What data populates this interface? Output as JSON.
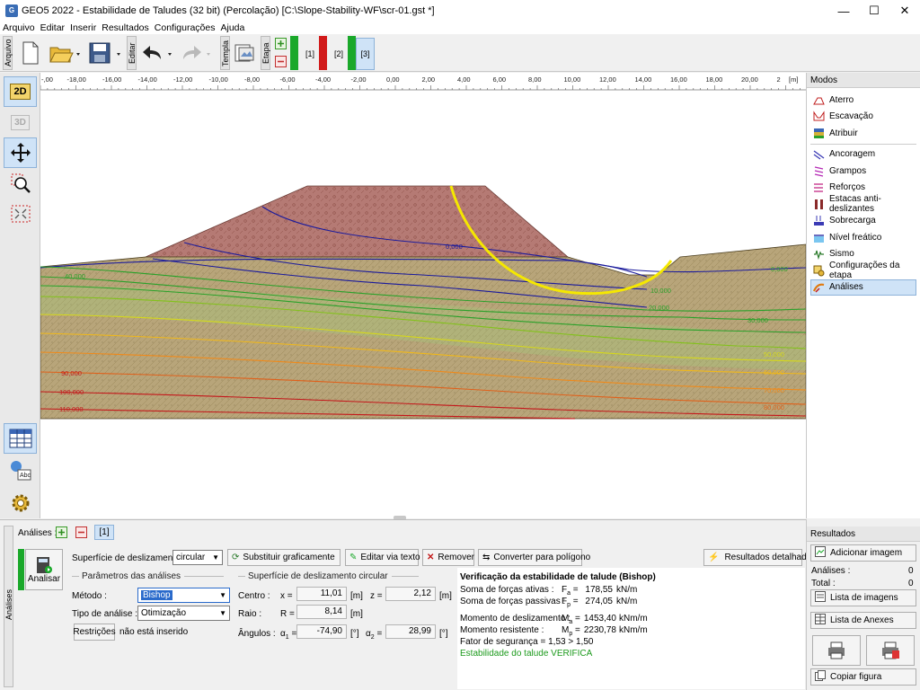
{
  "window": {
    "title": "GEO5 2022 - Estabilidade de Taludes (32 bit) (Percolação) [C:\\Slope-Stability-WF\\scr-01.gst *]",
    "app_icon": "G",
    "minimize": "—",
    "maximize": "☐",
    "close": "✕"
  },
  "menu": [
    "Arquivo",
    "Editar",
    "Inserir",
    "Resultados",
    "Configurações",
    "Ajuda"
  ],
  "toolbar": {
    "arquivo_tab": "Arquivo",
    "editar_tab": "Editar",
    "templa_tab": "Templa",
    "etapa_tab": "Etapa",
    "stages": [
      "[1]",
      "[2]",
      "[3]"
    ],
    "active_stage": "[3]"
  },
  "ruler": {
    "unit": "[m]",
    "ticks": [
      "-,00",
      "-18,00",
      "-16,00",
      "-14,00",
      "-12,00",
      "-10,00",
      "-8,00",
      "-6,00",
      "-4,00",
      "-2,00",
      "0,00",
      "2,00",
      "4,00",
      "6,00",
      "8,00",
      "10,00",
      "12,00",
      "14,00",
      "16,00",
      "18,00",
      "20,00",
      "2"
    ]
  },
  "left_tools": {
    "view2d": "2D",
    "view3d": "3D"
  },
  "drawing": {
    "contour_labels_left": [
      "40,000",
      "90,000",
      "100,000",
      "110,000"
    ],
    "contour_labels_right": [
      "0,000",
      "10,000",
      "20,000",
      "30,000",
      "50,000",
      "60,000",
      "70,000",
      "80,000"
    ],
    "contour_label_embank": "0,000",
    "colors": {
      "embankment": "#b57a74",
      "soil": "#b8a57a",
      "phreatic": "#1b1b9c",
      "slip_circle": "#f5e800"
    }
  },
  "modes": {
    "header": "Modos",
    "items": [
      "Aterro",
      "Escavação",
      "Atribuir",
      "Ancoragem",
      "Grampos",
      "Reforços",
      "Estacas anti-deslizantes",
      "Sobrecarga",
      "Nível freático",
      "Sismo",
      "Configurações da etapa",
      "Análises"
    ],
    "active": "Análises"
  },
  "analysis": {
    "tab_label": "Análises :",
    "stage_tag": "[1]",
    "side_tab": "Análises",
    "analyze_button": "Analisar",
    "surface_label": "Superfície de deslizamento :",
    "surface_value": "circular",
    "buttons": {
      "replace": "Substituir graficamente",
      "edit_text": "Editar via texto",
      "remove": "Remover",
      "convert": "Converter para polígono",
      "detailed": "Resultados detalhados"
    },
    "params_title": "Parâmetros das análises",
    "method_label": "Método :",
    "method_value": "Bishop",
    "type_label": "Tipo de análise :",
    "type_value": "Otimização",
    "restrictions_button": "Restrições",
    "restrictions_text": "não está inserido",
    "circle_title": "Superfície de deslizamento circular",
    "center_label": "Centro :",
    "x_label": "x =",
    "x_value": "11,01",
    "z_label": "z =",
    "z_value": "2,12",
    "radius_label": "Raio :",
    "r_label": "R =",
    "r_value": "8,14",
    "angles_label": "Ângulos :",
    "a1_label": "α",
    "a1_value": "-74,90",
    "a2_value": "28,99",
    "unit_m": "[m]",
    "unit_deg": "[°]",
    "results": {
      "title": "Verificação da estabilidade de talude (Bishop)",
      "active_label": "Soma de forças ativas :",
      "active_value": "178,55",
      "passive_label": "Soma de forças passivas :",
      "passive_value": "274,05",
      "force_unit": "kN/m",
      "md_label": "Momento de deslizamento :",
      "md_value": "1453,40",
      "mr_label": "Momento resistente :",
      "mr_value": "2230,78",
      "moment_unit": "kNm/m",
      "fs_text": "Fator de segurança = 1,53 > 1,50",
      "verdict": "Estabilidade do talude VERIFICA"
    }
  },
  "results_panel": {
    "header": "Resultados",
    "add_image": "Adicionar imagem",
    "analyses_label": "Análises :",
    "analyses_value": "0",
    "total_label": "Total :",
    "total_value": "0",
    "image_list": "Lista de imagens",
    "annex_list": "Lista de Anexes",
    "copy_figure": "Copiar figura"
  }
}
